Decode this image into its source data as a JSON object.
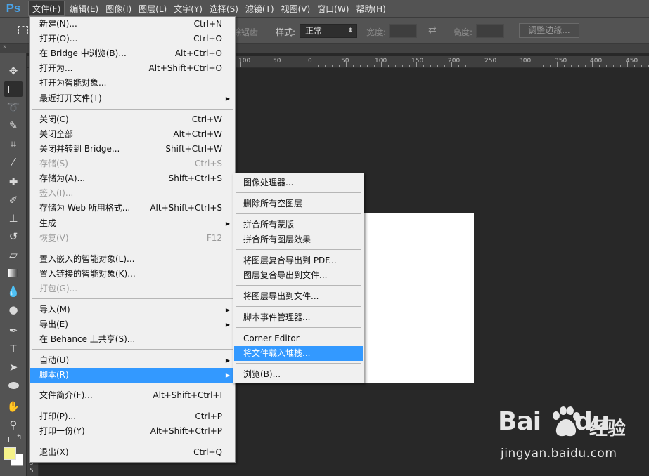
{
  "app": {
    "logo": "Ps"
  },
  "menubar": [
    {
      "label": "文件(F)",
      "active": true
    },
    {
      "label": "编辑(E)"
    },
    {
      "label": "图像(I)"
    },
    {
      "label": "图层(L)"
    },
    {
      "label": "文字(Y)"
    },
    {
      "label": "选择(S)"
    },
    {
      "label": "滤镜(T)"
    },
    {
      "label": "视图(V)"
    },
    {
      "label": "窗口(W)"
    },
    {
      "label": "帮助(H)"
    }
  ],
  "options": {
    "anti_alias_label": "除锯齿",
    "style_label": "样式:",
    "style_value": "正常",
    "width_label": "宽度:",
    "height_label": "高度:",
    "adjust_edge_label": "调整边缘..."
  },
  "ruler": {
    "top_numbers": [
      "100",
      "50",
      "0",
      "50",
      "100",
      "150",
      "200",
      "250",
      "300",
      "350",
      "400",
      "450"
    ],
    "left_numbers": [
      "3",
      "5"
    ]
  },
  "file_menu": {
    "items": [
      {
        "label": "新建(N)...",
        "shortcut": "Ctrl+N"
      },
      {
        "label": "打开(O)...",
        "shortcut": "Ctrl+O"
      },
      {
        "label": "在 Bridge 中浏览(B)...",
        "shortcut": "Alt+Ctrl+O"
      },
      {
        "label": "打开为...",
        "shortcut": "Alt+Shift+Ctrl+O"
      },
      {
        "label": "打开为智能对象...",
        "shortcut": ""
      },
      {
        "label": "最近打开文件(T)",
        "shortcut": "",
        "submenu": true
      },
      {
        "label": "关闭(C)",
        "shortcut": "Ctrl+W"
      },
      {
        "label": "关闭全部",
        "shortcut": "Alt+Ctrl+W"
      },
      {
        "label": "关闭并转到 Bridge...",
        "shortcut": "Shift+Ctrl+W"
      },
      {
        "label": "存储(S)",
        "shortcut": "Ctrl+S",
        "disabled": true
      },
      {
        "label": "存储为(A)...",
        "shortcut": "Shift+Ctrl+S"
      },
      {
        "label": "签入(I)...",
        "shortcut": "",
        "disabled": true
      },
      {
        "label": "存储为 Web 所用格式...",
        "shortcut": "Alt+Shift+Ctrl+S"
      },
      {
        "label": "生成",
        "shortcut": "",
        "submenu": true
      },
      {
        "label": "恢复(V)",
        "shortcut": "F12",
        "disabled": true
      },
      {
        "label": "置入嵌入的智能对象(L)...",
        "shortcut": ""
      },
      {
        "label": "置入链接的智能对象(K)...",
        "shortcut": ""
      },
      {
        "label": "打包(G)...",
        "shortcut": "",
        "disabled": true
      },
      {
        "label": "导入(M)",
        "shortcut": "",
        "submenu": true
      },
      {
        "label": "导出(E)",
        "shortcut": "",
        "submenu": true
      },
      {
        "label": "在 Behance 上共享(S)...",
        "shortcut": ""
      },
      {
        "label": "自动(U)",
        "shortcut": "",
        "submenu": true
      },
      {
        "label": "脚本(R)",
        "shortcut": "",
        "submenu": true,
        "highlight": true
      },
      {
        "label": "文件简介(F)...",
        "shortcut": "Alt+Shift+Ctrl+I"
      },
      {
        "label": "打印(P)...",
        "shortcut": "Ctrl+P"
      },
      {
        "label": "打印一份(Y)",
        "shortcut": "Alt+Shift+Ctrl+P"
      },
      {
        "label": "退出(X)",
        "shortcut": "Ctrl+Q"
      }
    ]
  },
  "scripts_menu": {
    "items": [
      {
        "label": "图像处理器..."
      },
      {
        "label": "删除所有空图层"
      },
      {
        "label": "拼合所有蒙版"
      },
      {
        "label": "拼合所有图层效果"
      },
      {
        "label": "将图层复合导出到 PDF..."
      },
      {
        "label": "图层复合导出到文件..."
      },
      {
        "label": "将图层导出到文件..."
      },
      {
        "label": "脚本事件管理器..."
      },
      {
        "label": "Corner Editor"
      },
      {
        "label": "将文件载入堆栈...",
        "highlight": true
      },
      {
        "label": "浏览(B)..."
      }
    ]
  },
  "colors": {
    "foreground": "#f5f28a",
    "background": "#ffffff",
    "highlight": "#3399ff"
  },
  "watermark": {
    "word": "Bai",
    "word2": "du",
    "cn": "经验",
    "url": "jingyan.baidu.com"
  }
}
